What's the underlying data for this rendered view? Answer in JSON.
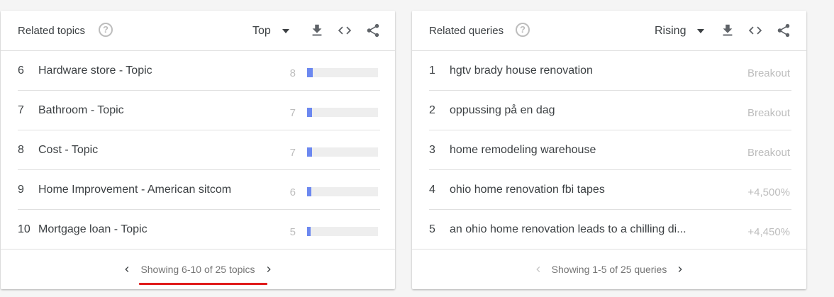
{
  "topics": {
    "title": "Related topics",
    "help_icon": "help-circle-icon",
    "select_label": "Top",
    "icons": [
      "download-icon",
      "embed-code-icon",
      "share-icon"
    ],
    "rows": [
      {
        "rank": "6",
        "label": "Hardware store - Topic",
        "value": "8",
        "fraction": 0.08
      },
      {
        "rank": "7",
        "label": "Bathroom - Topic",
        "value": "7",
        "fraction": 0.07
      },
      {
        "rank": "8",
        "label": "Cost - Topic",
        "value": "7",
        "fraction": 0.07
      },
      {
        "rank": "9",
        "label": "Home Improvement - American sitcom",
        "value": "6",
        "fraction": 0.06
      },
      {
        "rank": "10",
        "label": "Mortgage loan - Topic",
        "value": "5",
        "fraction": 0.05
      }
    ],
    "pager_text": "Showing 6-10 of 25 topics"
  },
  "queries": {
    "title": "Related queries",
    "help_icon": "help-circle-icon",
    "select_label": "Rising",
    "icons": [
      "download-icon",
      "embed-code-icon",
      "share-icon"
    ],
    "rows": [
      {
        "rank": "1",
        "label": "hgtv brady house renovation",
        "value": "Breakout"
      },
      {
        "rank": "2",
        "label": "oppussing på en dag",
        "value": "Breakout"
      },
      {
        "rank": "3",
        "label": "home remodeling warehouse",
        "value": "Breakout"
      },
      {
        "rank": "4",
        "label": "ohio home renovation fbi tapes",
        "value": "+4,500%"
      },
      {
        "rank": "5",
        "label": "an ohio home renovation leads to a chilling di...",
        "value": "+4,450%"
      }
    ],
    "pager_text": "Showing 1-5 of 25 queries"
  },
  "colors": {
    "bar_fill": "#6c88f0",
    "bar_track": "#eeeeee",
    "highlight_underline": "#e01b1b"
  }
}
